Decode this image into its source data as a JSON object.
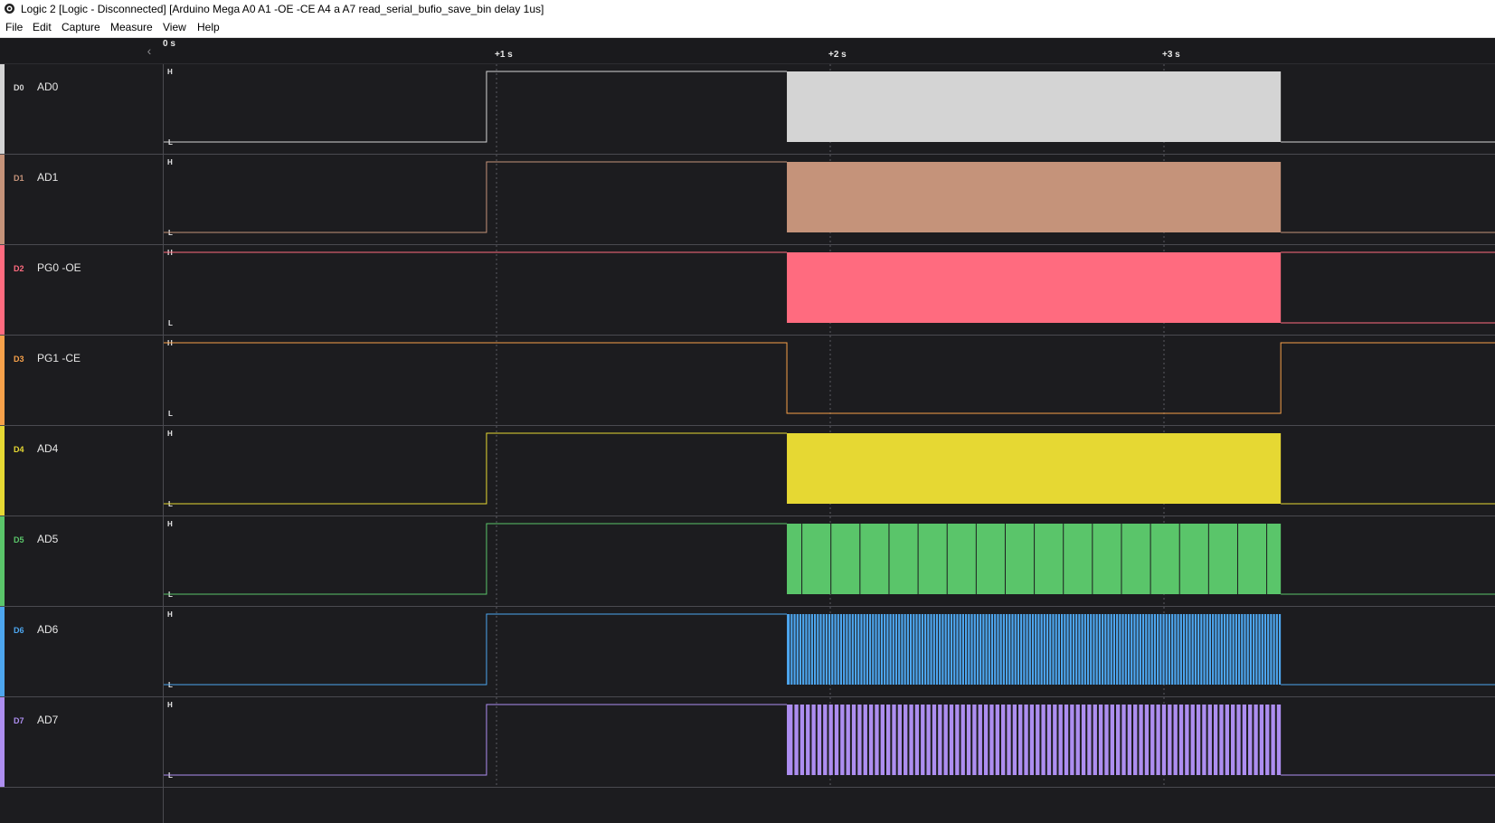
{
  "window": {
    "title": "Logic 2 [Logic - Disconnected] [Arduino Mega A0 A1 -OE -CE A4 a A7 read_serial_bufio_save_bin delay 1us]"
  },
  "menu": {
    "items": [
      "File",
      "Edit",
      "Capture",
      "Measure",
      "View",
      "Help"
    ]
  },
  "ruler": {
    "start_label": "0 s",
    "ticks": [
      {
        "label": "+1 s",
        "t": 1
      },
      {
        "label": "+2 s",
        "t": 2
      },
      {
        "label": "+3 s",
        "t": 3
      }
    ]
  },
  "level_labels": {
    "high": "H",
    "low": "L"
  },
  "colors": {
    "background": "#1c1c1f",
    "separator": "#4a4a50",
    "grid": "#5a5a60"
  },
  "channels": [
    {
      "id": "D0",
      "name": "AD0",
      "color": "#d4d4d4",
      "initial": 0,
      "edges": [
        0.97
      ],
      "burst": "solid"
    },
    {
      "id": "D1",
      "name": "AD1",
      "color": "#c5937a",
      "initial": 0,
      "edges": [
        0.97
      ],
      "burst": "solid"
    },
    {
      "id": "D2",
      "name": "PG0 -OE",
      "color": "#ff6b7f",
      "initial": 1,
      "edges": [],
      "burst": "solid"
    },
    {
      "id": "D3",
      "name": "PG1 -CE",
      "color": "#f7a14a",
      "initial": 1,
      "edges": [
        1.87,
        3.35
      ],
      "burst": "none"
    },
    {
      "id": "D4",
      "name": "AD4",
      "color": "#e6d833",
      "initial": 0,
      "edges": [
        0.97
      ],
      "burst": "solid"
    },
    {
      "id": "D5",
      "name": "AD5",
      "color": "#5ac56a",
      "initial": 0,
      "edges": [
        0.97
      ],
      "burst": "sparse"
    },
    {
      "id": "D6",
      "name": "AD6",
      "color": "#4da6ef",
      "initial": 0,
      "edges": [
        0.97
      ],
      "burst": "dense"
    },
    {
      "id": "D7",
      "name": "AD7",
      "color": "#ad8ef0",
      "initial": 0,
      "edges": [
        0.97
      ],
      "burst": "medium"
    }
  ],
  "burst_window": {
    "start": 1.87,
    "end": 3.35
  }
}
